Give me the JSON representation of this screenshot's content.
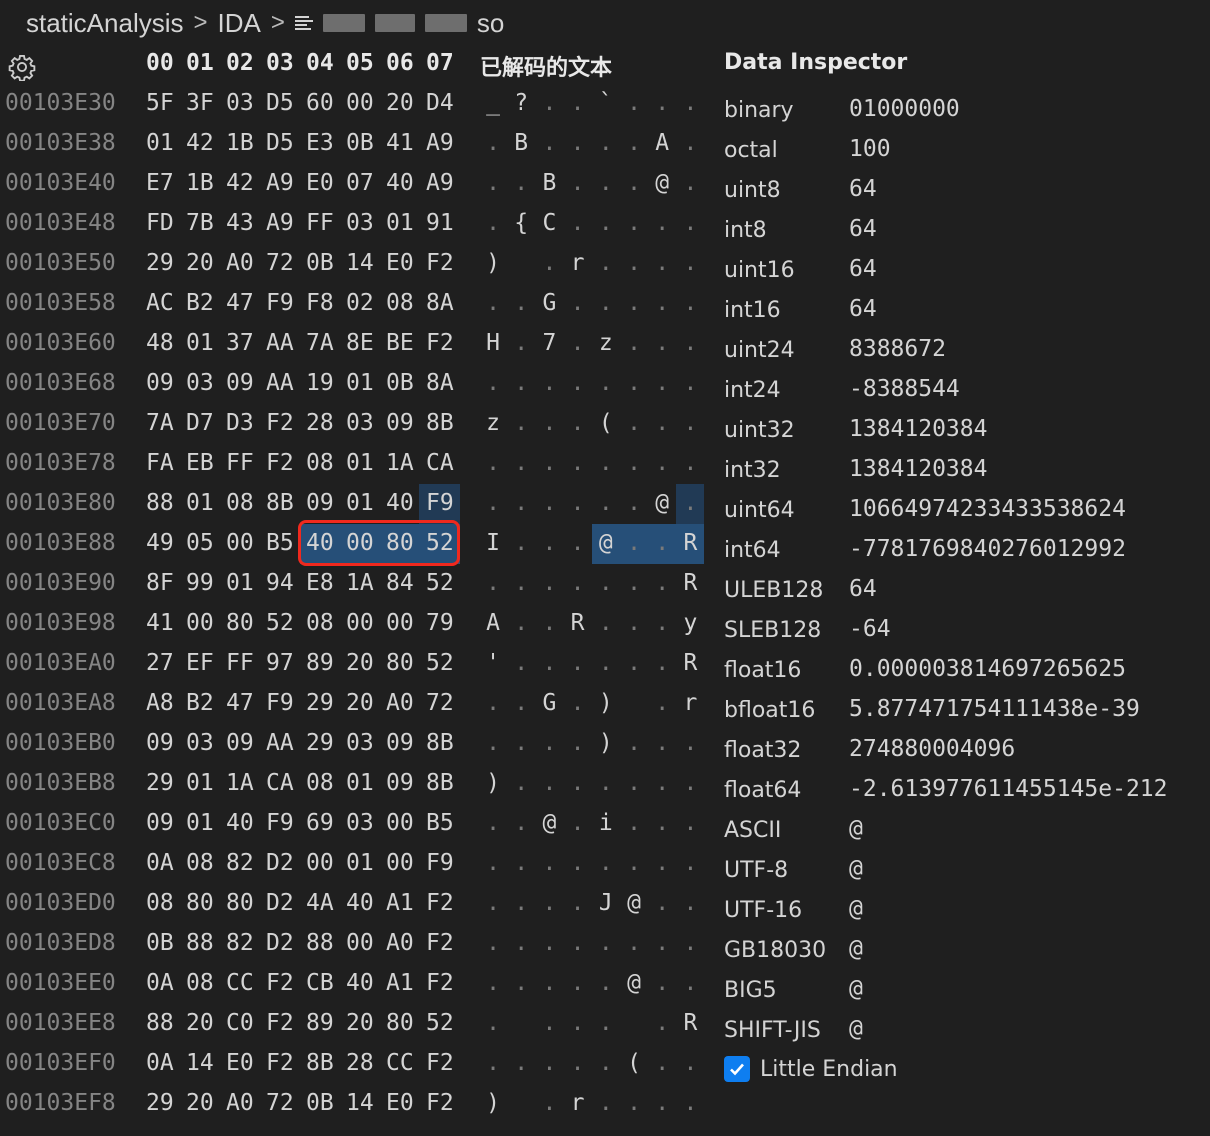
{
  "breadcrumb": {
    "root": "staticAnalysis",
    "folder": "IDA",
    "file_suffix": "so"
  },
  "header": {
    "columns": [
      "00",
      "01",
      "02",
      "03",
      "04",
      "05",
      "06",
      "07"
    ],
    "decoded_title": "已解码的文本"
  },
  "rows": [
    {
      "addr": "00103E30",
      "bytes": [
        "5F",
        "3F",
        "03",
        "D5",
        "60",
        "00",
        "20",
        "D4"
      ],
      "text": [
        "_",
        "?",
        ".",
        ".",
        "`",
        ".",
        ".",
        "."
      ]
    },
    {
      "addr": "00103E38",
      "bytes": [
        "01",
        "42",
        "1B",
        "D5",
        "E3",
        "0B",
        "41",
        "A9"
      ],
      "text": [
        ".",
        "B",
        ".",
        ".",
        ".",
        ".",
        "A",
        "."
      ]
    },
    {
      "addr": "00103E40",
      "bytes": [
        "E7",
        "1B",
        "42",
        "A9",
        "E0",
        "07",
        "40",
        "A9"
      ],
      "text": [
        ".",
        ".",
        "B",
        ".",
        ".",
        ".",
        "@",
        "."
      ]
    },
    {
      "addr": "00103E48",
      "bytes": [
        "FD",
        "7B",
        "43",
        "A9",
        "FF",
        "03",
        "01",
        "91"
      ],
      "text": [
        ".",
        "{",
        "C",
        ".",
        ".",
        ".",
        ".",
        "."
      ]
    },
    {
      "addr": "00103E50",
      "bytes": [
        "29",
        "20",
        "A0",
        "72",
        "0B",
        "14",
        "E0",
        "F2"
      ],
      "text": [
        ")",
        " ",
        ".",
        "r",
        ".",
        ".",
        ".",
        "."
      ]
    },
    {
      "addr": "00103E58",
      "bytes": [
        "AC",
        "B2",
        "47",
        "F9",
        "F8",
        "02",
        "08",
        "8A"
      ],
      "text": [
        ".",
        ".",
        "G",
        ".",
        ".",
        ".",
        ".",
        "."
      ]
    },
    {
      "addr": "00103E60",
      "bytes": [
        "48",
        "01",
        "37",
        "AA",
        "7A",
        "8E",
        "BE",
        "F2"
      ],
      "text": [
        "H",
        ".",
        "7",
        ".",
        "z",
        ".",
        ".",
        "."
      ]
    },
    {
      "addr": "00103E68",
      "bytes": [
        "09",
        "03",
        "09",
        "AA",
        "19",
        "01",
        "0B",
        "8A"
      ],
      "text": [
        ".",
        ".",
        ".",
        ".",
        ".",
        ".",
        ".",
        "."
      ]
    },
    {
      "addr": "00103E70",
      "bytes": [
        "7A",
        "D7",
        "D3",
        "F2",
        "28",
        "03",
        "09",
        "8B"
      ],
      "text": [
        "z",
        ".",
        ".",
        ".",
        "(",
        ".",
        ".",
        "."
      ]
    },
    {
      "addr": "00103E78",
      "bytes": [
        "FA",
        "EB",
        "FF",
        "F2",
        "08",
        "01",
        "1A",
        "CA"
      ],
      "text": [
        ".",
        ".",
        ".",
        ".",
        ".",
        ".",
        ".",
        "."
      ]
    },
    {
      "addr": "00103E80",
      "bytes": [
        "88",
        "01",
        "08",
        "8B",
        "09",
        "01",
        "40",
        "F9"
      ],
      "text": [
        ".",
        ".",
        ".",
        ".",
        ".",
        ".",
        "@",
        "."
      ]
    },
    {
      "addr": "00103E88",
      "bytes": [
        "49",
        "05",
        "00",
        "B5",
        "40",
        "00",
        "80",
        "52"
      ],
      "text": [
        "I",
        ".",
        ".",
        ".",
        "@",
        ".",
        ".",
        "R"
      ]
    },
    {
      "addr": "00103E90",
      "bytes": [
        "8F",
        "99",
        "01",
        "94",
        "E8",
        "1A",
        "84",
        "52"
      ],
      "text": [
        ".",
        ".",
        ".",
        ".",
        ".",
        ".",
        ".",
        "R"
      ]
    },
    {
      "addr": "00103E98",
      "bytes": [
        "41",
        "00",
        "80",
        "52",
        "08",
        "00",
        "00",
        "79"
      ],
      "text": [
        "A",
        ".",
        ".",
        "R",
        ".",
        ".",
        ".",
        "y"
      ]
    },
    {
      "addr": "00103EA0",
      "bytes": [
        "27",
        "EF",
        "FF",
        "97",
        "89",
        "20",
        "80",
        "52"
      ],
      "text": [
        "'",
        ".",
        ".",
        ".",
        ".",
        ".",
        ".",
        "R"
      ]
    },
    {
      "addr": "00103EA8",
      "bytes": [
        "A8",
        "B2",
        "47",
        "F9",
        "29",
        "20",
        "A0",
        "72"
      ],
      "text": [
        ".",
        ".",
        "G",
        ".",
        ")",
        " ",
        ".",
        "r"
      ]
    },
    {
      "addr": "00103EB0",
      "bytes": [
        "09",
        "03",
        "09",
        "AA",
        "29",
        "03",
        "09",
        "8B"
      ],
      "text": [
        ".",
        ".",
        ".",
        ".",
        ")",
        ".",
        ".",
        "."
      ]
    },
    {
      "addr": "00103EB8",
      "bytes": [
        "29",
        "01",
        "1A",
        "CA",
        "08",
        "01",
        "09",
        "8B"
      ],
      "text": [
        ")",
        ".",
        ".",
        ".",
        ".",
        ".",
        ".",
        "."
      ]
    },
    {
      "addr": "00103EC0",
      "bytes": [
        "09",
        "01",
        "40",
        "F9",
        "69",
        "03",
        "00",
        "B5"
      ],
      "text": [
        ".",
        ".",
        "@",
        ".",
        "i",
        ".",
        ".",
        "."
      ]
    },
    {
      "addr": "00103EC8",
      "bytes": [
        "0A",
        "08",
        "82",
        "D2",
        "00",
        "01",
        "00",
        "F9"
      ],
      "text": [
        ".",
        ".",
        ".",
        ".",
        ".",
        ".",
        ".",
        "."
      ]
    },
    {
      "addr": "00103ED0",
      "bytes": [
        "08",
        "80",
        "80",
        "D2",
        "4A",
        "40",
        "A1",
        "F2"
      ],
      "text": [
        ".",
        ".",
        ".",
        ".",
        "J",
        "@",
        ".",
        "."
      ]
    },
    {
      "addr": "00103ED8",
      "bytes": [
        "0B",
        "88",
        "82",
        "D2",
        "88",
        "00",
        "A0",
        "F2"
      ],
      "text": [
        ".",
        ".",
        ".",
        ".",
        ".",
        ".",
        ".",
        "."
      ]
    },
    {
      "addr": "00103EE0",
      "bytes": [
        "0A",
        "08",
        "CC",
        "F2",
        "CB",
        "40",
        "A1",
        "F2"
      ],
      "text": [
        ".",
        ".",
        ".",
        ".",
        ".",
        "@",
        ".",
        "."
      ]
    },
    {
      "addr": "00103EE8",
      "bytes": [
        "88",
        "20",
        "C0",
        "F2",
        "89",
        "20",
        "80",
        "52"
      ],
      "text": [
        ".",
        " ",
        ".",
        ".",
        ".",
        " ",
        ".",
        "R"
      ]
    },
    {
      "addr": "00103EF0",
      "bytes": [
        "0A",
        "14",
        "E0",
        "F2",
        "8B",
        "28",
        "CC",
        "F2"
      ],
      "text": [
        ".",
        ".",
        ".",
        ".",
        ".",
        "(",
        ".",
        "."
      ]
    },
    {
      "addr": "00103EF8",
      "bytes": [
        "29",
        "20",
        "A0",
        "72",
        "0B",
        "14",
        "E0",
        "F2"
      ],
      "text": [
        ")",
        " ",
        ".",
        "r",
        ".",
        ".",
        ".",
        "."
      ]
    }
  ],
  "inspector": {
    "title": "Data Inspector",
    "fields": [
      {
        "label": "binary",
        "value": "01000000"
      },
      {
        "label": "octal",
        "value": "100"
      },
      {
        "label": "uint8",
        "value": "64"
      },
      {
        "label": "int8",
        "value": "64"
      },
      {
        "label": "uint16",
        "value": "64"
      },
      {
        "label": "int16",
        "value": "64"
      },
      {
        "label": "uint24",
        "value": "8388672"
      },
      {
        "label": "int24",
        "value": "-8388544"
      },
      {
        "label": "uint32",
        "value": "1384120384"
      },
      {
        "label": "int32",
        "value": "1384120384"
      },
      {
        "label": "uint64",
        "value": "10664974233433538624"
      },
      {
        "label": "int64",
        "value": "-7781769840276012992"
      },
      {
        "label": "ULEB128",
        "value": "64"
      },
      {
        "label": "SLEB128",
        "value": "-64"
      },
      {
        "label": "float16",
        "value": "0.000003814697265625"
      },
      {
        "label": "bfloat16",
        "value": "5.877471754111438e-39"
      },
      {
        "label": "float32",
        "value": "274880004096"
      },
      {
        "label": "float64",
        "value": "-2.613977611455145e-212"
      },
      {
        "label": "ASCII",
        "value": "@"
      },
      {
        "label": "UTF-8",
        "value": "@"
      },
      {
        "label": "UTF-16",
        "value": "@"
      },
      {
        "label": "GB18030",
        "value": "@"
      },
      {
        "label": "BIG5",
        "value": "@"
      },
      {
        "label": "SHIFT-JIS",
        "value": "@"
      }
    ],
    "little_endian_label": "Little Endian",
    "little_endian_checked": true
  },
  "colors": {
    "background": "#1f1f1f",
    "selection": "#264f78",
    "highlight_border": "#f0291e",
    "checkbox": "#0e7ef0"
  }
}
